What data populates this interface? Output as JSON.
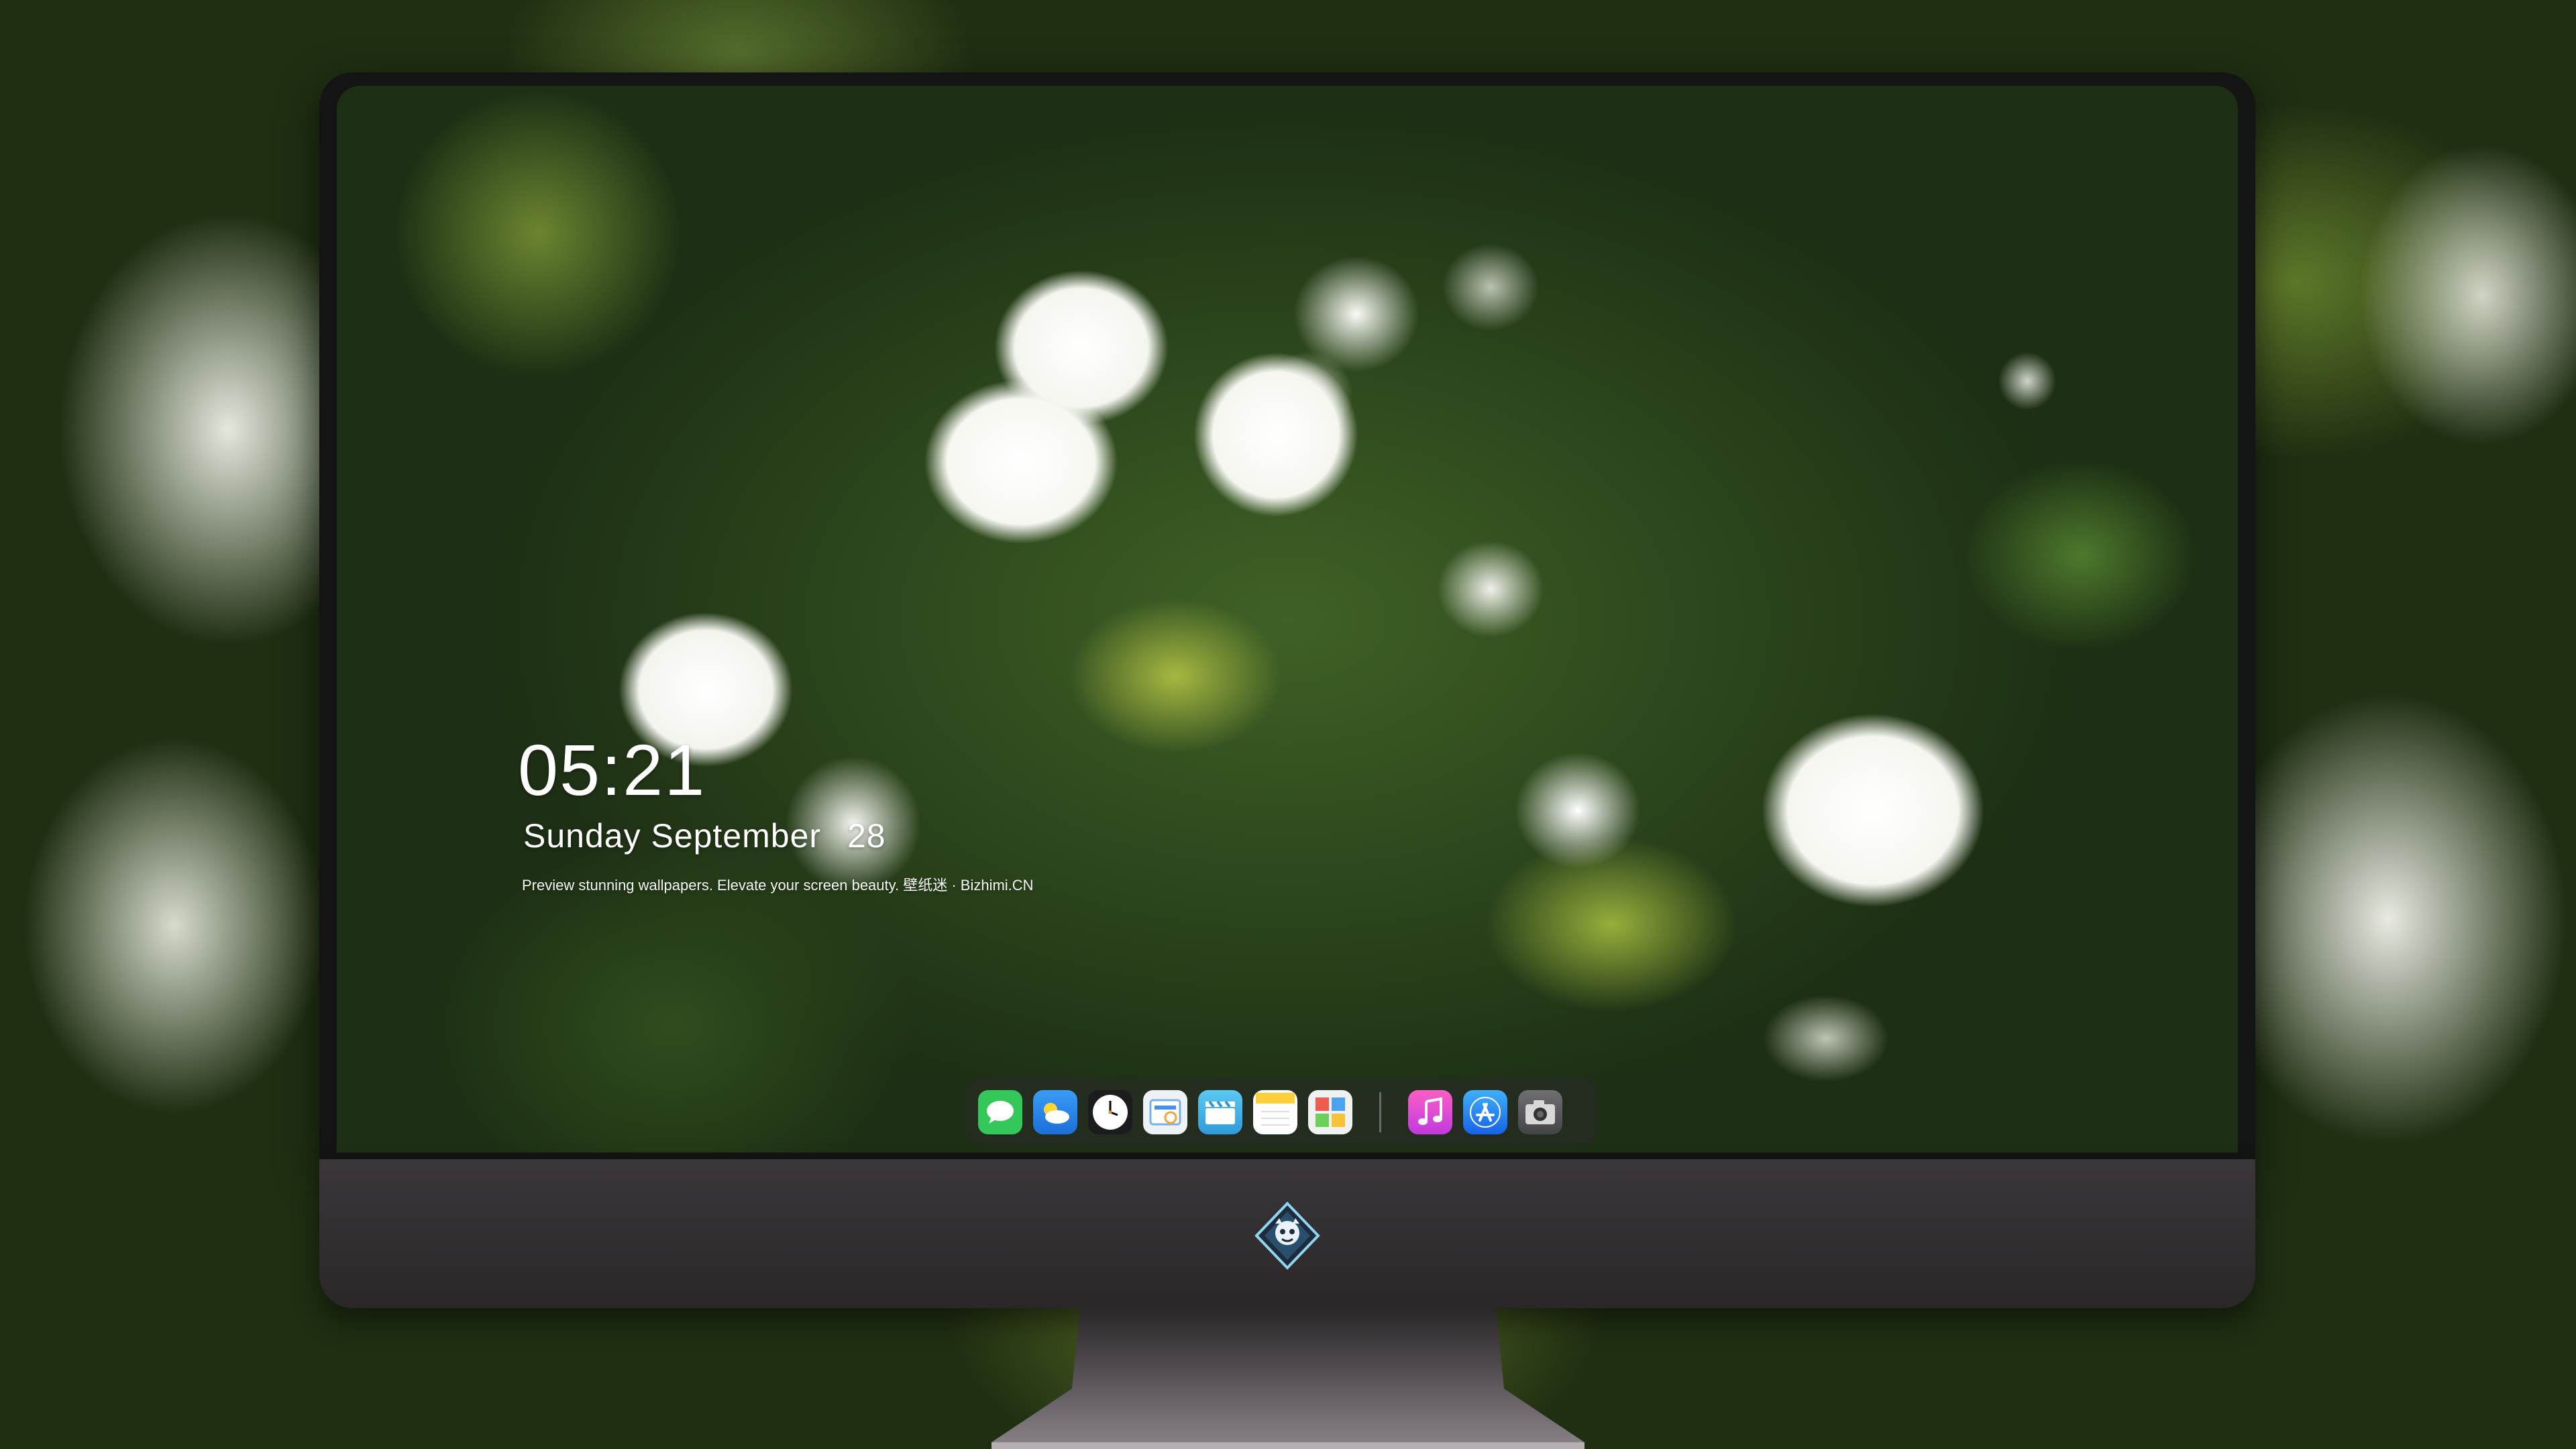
{
  "lock_screen": {
    "time": "05:21",
    "date_weekday_month": "Sunday September",
    "date_day": "28",
    "tagline": "Preview stunning wallpapers. Elevate your screen beauty. 壁纸迷 · Bizhimi.CN"
  },
  "dock": {
    "apps": [
      {
        "icon": "messages-icon",
        "color": "#34c759"
      },
      {
        "icon": "weather-icon",
        "color": "#2f8cf0"
      },
      {
        "icon": "clock-icon",
        "color": "#1c1c1e"
      },
      {
        "icon": "preview-icon",
        "color": "#e8edf2"
      },
      {
        "icon": "video-clips-icon",
        "color": "#43b5e8"
      },
      {
        "icon": "notes-icon",
        "color": "#fdfdfd"
      },
      {
        "icon": "photo-booth-icon",
        "color": "#f1f1f1"
      },
      {
        "icon": "music-icon",
        "color": "#f04fb0"
      },
      {
        "icon": "app-store-icon",
        "color": "#1f8cf5"
      },
      {
        "icon": "camera-icon",
        "color": "#5a5a5c"
      }
    ]
  },
  "colors": {
    "screen_text": "#ffffff",
    "chin": "#332f31",
    "bezel": "#141414"
  }
}
